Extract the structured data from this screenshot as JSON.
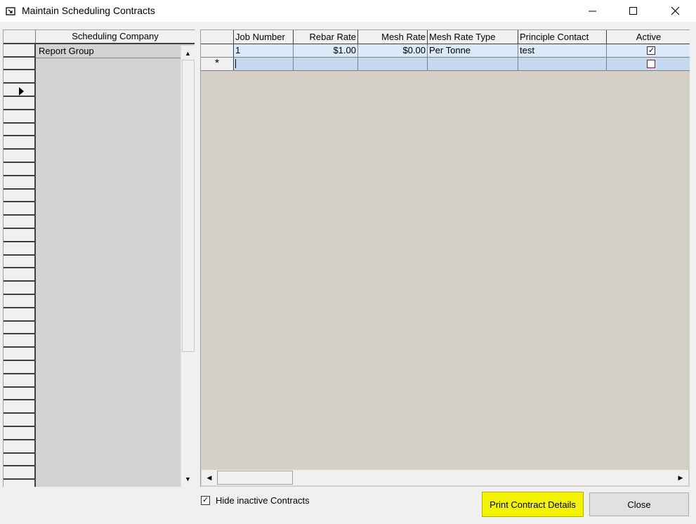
{
  "window": {
    "title": "Maintain Scheduling Contracts",
    "icon": "form-icon",
    "controls": {
      "minimize": "minimize-icon",
      "maximize": "maximize-icon",
      "close": "close-icon"
    }
  },
  "left_grid": {
    "header": "Scheduling Company",
    "rows": [
      "Report Group"
    ]
  },
  "right_grid": {
    "columns": [
      "Job Number",
      "Rebar Rate",
      "Mesh Rate",
      "Mesh Rate Type",
      "Principle Contact",
      "Active"
    ],
    "rows": [
      {
        "job_number": "1",
        "rebar_rate": "$1.00",
        "mesh_rate": "$0.00",
        "mesh_rate_type": "Per Tonne",
        "principle_contact": "test",
        "active": true
      }
    ],
    "new_row_marker": "*"
  },
  "footer": {
    "hide_inactive_label": "Hide inactive Contracts",
    "hide_inactive_checked": true,
    "print_button": "Print Contract Details",
    "close_button": "Close"
  },
  "colors": {
    "print_highlight": "#f4f400",
    "grid_bg": "#d4d0c8",
    "row_highlight": "#dbe9f9"
  }
}
